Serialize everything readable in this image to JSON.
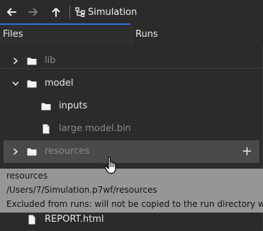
{
  "toolbar": {
    "back_icon": "arrow-left-icon",
    "forward_icon": "arrow-right-icon",
    "up_icon": "arrow-up-icon",
    "title_icon": "hierarchy-icon",
    "title": "Simulation"
  },
  "tabs": [
    {
      "label": "Files",
      "active": true
    },
    {
      "label": "Runs",
      "active": false
    }
  ],
  "tree": [
    {
      "label": "lib",
      "type": "folder",
      "dimmed": true,
      "expander": "chevron-right"
    },
    {
      "label": "model",
      "type": "folder",
      "dimmed": false,
      "expander": "chevron-down"
    },
    {
      "label": "inputs",
      "type": "folder",
      "dimmed": false
    },
    {
      "label": "large model.bin",
      "type": "file",
      "dimmed": true
    },
    {
      "label": "resources",
      "type": "folder",
      "dimmed": true,
      "expander": "chevron-right",
      "hovered": true,
      "action": "+"
    },
    {
      "label": "REPORT.html",
      "type": "file",
      "dimmed": false
    }
  ],
  "tooltip": {
    "line1": "resources",
    "line2": "/Users/7/Simulation.p7wf/resources",
    "line3": "Excluded from runs: will not be copied to the run directory w"
  },
  "colors": {
    "background": "#2b2b2b",
    "accent": "#2f6fe0",
    "hover": "#4a4a4a",
    "tooltip_bg": "#969696",
    "dim_text": "#8a8a8a"
  }
}
